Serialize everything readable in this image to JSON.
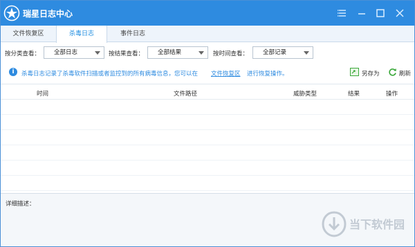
{
  "app": {
    "title": "瑞星日志中心"
  },
  "tabs": [
    {
      "label": "文件恢复区"
    },
    {
      "label": "杀毒日志"
    },
    {
      "label": "事件日志"
    }
  ],
  "filters": {
    "category": {
      "label": "按分类查看：",
      "value": "全部日志"
    },
    "result": {
      "label": "按结果查看：",
      "value": "全部结果"
    },
    "time": {
      "label": "按时间查看：",
      "value": "全部记录"
    }
  },
  "info": {
    "text": "杀毒日志记录了杀毒软件扫描或者监控到的所有病毒信息，您可以在",
    "link": "文件恢复区",
    "tail": "进行恢复操作。",
    "save_as": "另存为",
    "refresh": "刷新"
  },
  "table": {
    "columns": [
      "时间",
      "文件路径",
      "威胁类型",
      "结果",
      "操作"
    ],
    "rows": []
  },
  "detail": {
    "label": "详细描述："
  },
  "watermark": {
    "text": "当下软件园"
  },
  "colors": {
    "titlebar": "#2e8be0",
    "accent": "#1f8de0"
  }
}
